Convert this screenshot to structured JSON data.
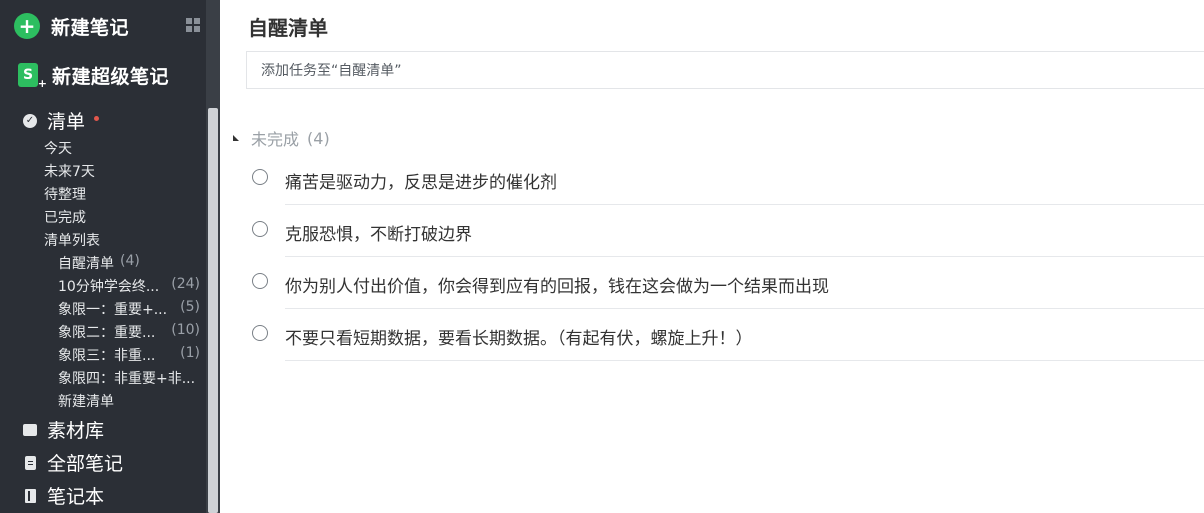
{
  "sidebar": {
    "new_note_label": "新建笔记",
    "new_super_note_label": "新建超级笔记",
    "lists_label": "清单",
    "sub_items": [
      "今天",
      "未来7天",
      "待整理",
      "已完成",
      "清单列表"
    ],
    "list_items": [
      {
        "label": "自醒清单",
        "count": "(4)"
      },
      {
        "label": "10分钟学会终...",
        "count": "(24)"
      },
      {
        "label": "象限一：重要+...",
        "count": "(5)"
      },
      {
        "label": "象限二：重要...",
        "count": "(10)"
      },
      {
        "label": "象限三：非重...",
        "count": "(1)"
      },
      {
        "label": "象限四：非重要+非...",
        "count": ""
      },
      {
        "label": "新建清单",
        "count": ""
      }
    ],
    "material_label": "素材库",
    "all_notes_label": "全部笔记",
    "notebooks_label": "笔记本"
  },
  "main": {
    "title": "自醒清单",
    "add_task_placeholder": "添加任务至“自醒清单”",
    "section": {
      "label": "未完成",
      "count": "(4)"
    },
    "tasks": [
      "痛苦是驱动力，反思是进步的催化剂",
      "克服恐惧，不断打破边界",
      "你为别人付出价值，你会得到应有的回报，钱在这会做为一个结果而出现",
      "不要只看短期数据，要看长期数据。（有起有伏，螺旋上升！）"
    ]
  },
  "colors": {
    "sidebar_bg": "#2b2f36",
    "accent_green": "#2dbe60",
    "badge_red": "#e2574c"
  }
}
